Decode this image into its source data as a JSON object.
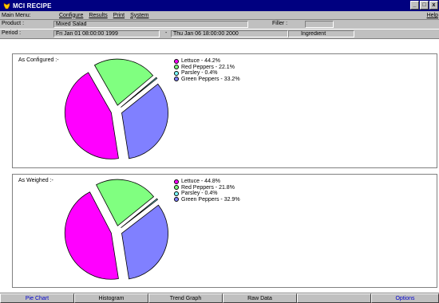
{
  "window": {
    "title": "MCI RECIPE",
    "minimize": "_",
    "maximize": "□",
    "close": "x"
  },
  "menu": {
    "label": "Main Menu:",
    "items": [
      "Configure",
      "Results",
      "Print",
      "System"
    ],
    "help": "Help"
  },
  "product": {
    "label": "Product :",
    "value": "Mixed Salad",
    "filler_label": "Filler :",
    "filler_value": ""
  },
  "period": {
    "label": "Period :",
    "start": "Fri Jan 01 08:00:00 1999",
    "separator": "-",
    "end": "Thu Jan 06 18:00:00 2000",
    "mode": "Ingredient"
  },
  "charts": [
    {
      "heading": "As Configured :-",
      "chart_data": {
        "type": "pie",
        "categories": [
          "Lettuce",
          "Red Peppers",
          "Parsley",
          "Green Peppers"
        ],
        "values": [
          44.2,
          22.1,
          0.4,
          33.2
        ],
        "legend_labels": [
          "Lettuce - 44.2%",
          "Red Peppers - 22.1%",
          "Parsley - 0.4%",
          "Green Peppers - 33.2%"
        ],
        "colors": [
          "#ff00ff",
          "#80ff80",
          "#80ffff",
          "#8080ff"
        ],
        "exploded": true
      }
    },
    {
      "heading": "As Weighed :-",
      "chart_data": {
        "type": "pie",
        "categories": [
          "Lettuce",
          "Red Peppers",
          "Parsley",
          "Green Peppers"
        ],
        "values": [
          44.8,
          21.8,
          0.4,
          32.9
        ],
        "legend_labels": [
          "Lettuce - 44.8%",
          "Red Peppers - 21.8%",
          "Parsley - 0.4%",
          "Green Peppers - 32.9%"
        ],
        "colors": [
          "#ff00ff",
          "#80ff80",
          "#80ffff",
          "#8080ff"
        ],
        "exploded": true
      }
    }
  ],
  "tabs": [
    "Pie Chart",
    "Histogram",
    "Trend Graph",
    "Raw Data",
    "",
    "Options"
  ],
  "colors": {
    "title_bar": "#000080",
    "face": "#c0c0c0",
    "active_tab_text": "#0000cc"
  }
}
